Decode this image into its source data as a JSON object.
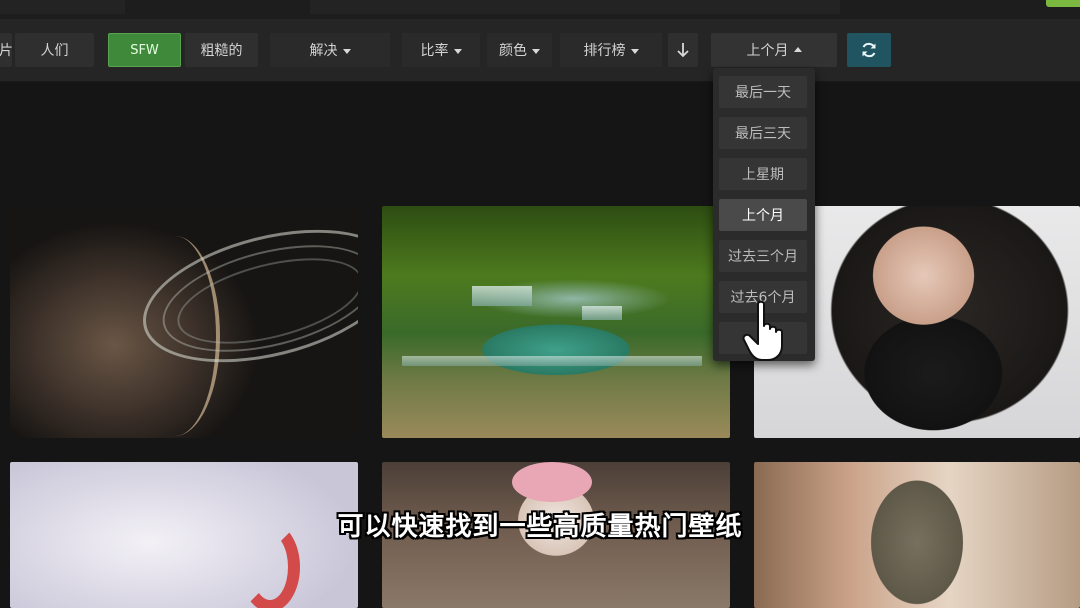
{
  "toolbar": {
    "categories_label_partial": "片",
    "people_label": "人们",
    "purity": {
      "sfw": "SFW",
      "sketchy": "粗糙的"
    },
    "resolution_label": "解决",
    "ratio_label": "比率",
    "color_label": "颜色",
    "sorting_label": "排行榜",
    "order_icon": "arrow-down-icon",
    "toprange_label": "上个月",
    "refresh_icon": "refresh-icon"
  },
  "dropdown": {
    "items": [
      "最后一天",
      "最后三天",
      "上星期",
      "上个月",
      "过去三个月",
      "过去6个月",
      ""
    ],
    "selected_index": 3
  },
  "thumbnails": [
    {
      "subject": "saturn"
    },
    {
      "subject": "forest-waterfall"
    },
    {
      "subject": "girl-sunglasses"
    },
    {
      "subject": "white-outfit"
    },
    {
      "subject": "classroom-girl"
    },
    {
      "subject": "girl-tan"
    }
  ],
  "caption": "可以快速找到一些高质量热门壁纸",
  "colors": {
    "sfw_green": "#3f8a3a",
    "refresh_teal": "#1f5460",
    "accent_green": "#7ab83f"
  }
}
